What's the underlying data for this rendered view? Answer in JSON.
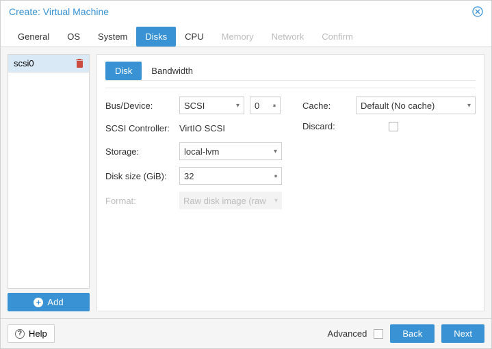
{
  "title": "Create: Virtual Machine",
  "tabs": [
    "General",
    "OS",
    "System",
    "Disks",
    "CPU",
    "Memory",
    "Network",
    "Confirm"
  ],
  "side": {
    "item": "scsi0",
    "add": "Add"
  },
  "subtabs": [
    "Disk",
    "Bandwidth"
  ],
  "left": {
    "bus_label": "Bus/Device:",
    "bus_value": "SCSI",
    "bus_index": "0",
    "ctrl_label": "SCSI Controller:",
    "ctrl_value": "VirtIO SCSI",
    "storage_label": "Storage:",
    "storage_value": "local-lvm",
    "size_label": "Disk size (GiB):",
    "size_value": "32",
    "format_label": "Format:",
    "format_value": "Raw disk image (raw"
  },
  "right": {
    "cache_label": "Cache:",
    "cache_value": "Default (No cache)",
    "discard_label": "Discard:"
  },
  "footer": {
    "help": "Help",
    "advanced": "Advanced",
    "back": "Back",
    "next": "Next"
  }
}
